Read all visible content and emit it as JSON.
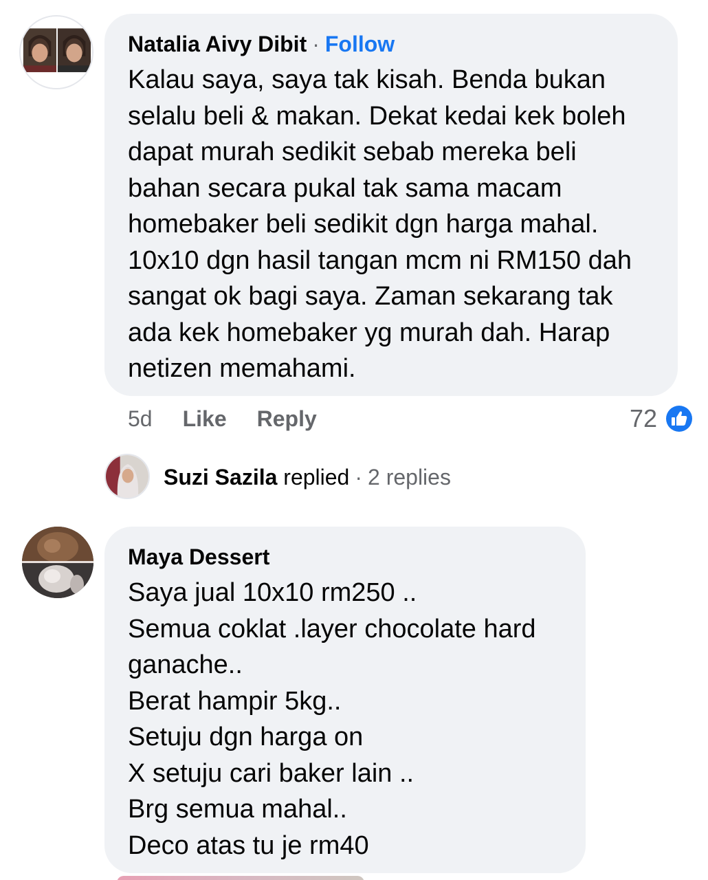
{
  "comments": [
    {
      "author": "Natalia Aivy Dibit",
      "separator": "·",
      "follow_label": "Follow",
      "text": "Kalau saya, saya tak kisah. Benda bukan\nselalu beli & makan. Dekat kedai kek boleh\ndapat murah sedikit sebab mereka beli\nbahan secara pukal tak sama macam\nhomebaker beli sedikit dgn harga mahal.\n10x10 dgn hasil tangan mcm ni RM150 dah\nsangat ok bagi saya. Zaman sekarang tak\nada kek homebaker yg murah dah. Harap\nnetizen memahami.",
      "time": "5d",
      "like_label": "Like",
      "reply_label": "Reply",
      "reaction_count": "72",
      "reaction_icon": "like-reaction-icon",
      "reply_summary": {
        "replier": "Suzi Sazila",
        "replied_label": "replied",
        "separator": "·",
        "count_text": "2 replies"
      }
    },
    {
      "author": "Maya Dessert",
      "text": "Saya jual 10x10 rm250 ..\nSemua coklat .layer chocolate hard\nganache..\nBerat hampir 5kg..\nSetuju dgn harga on\nX setuju cari baker lain ..\nBrg semua mahal..\nDeco atas tu je rm40"
    }
  ],
  "colors": {
    "bubble_bg": "#f0f2f5",
    "link_blue": "#1877f2",
    "secondary_text": "#65676b",
    "primary_text": "#050505"
  }
}
